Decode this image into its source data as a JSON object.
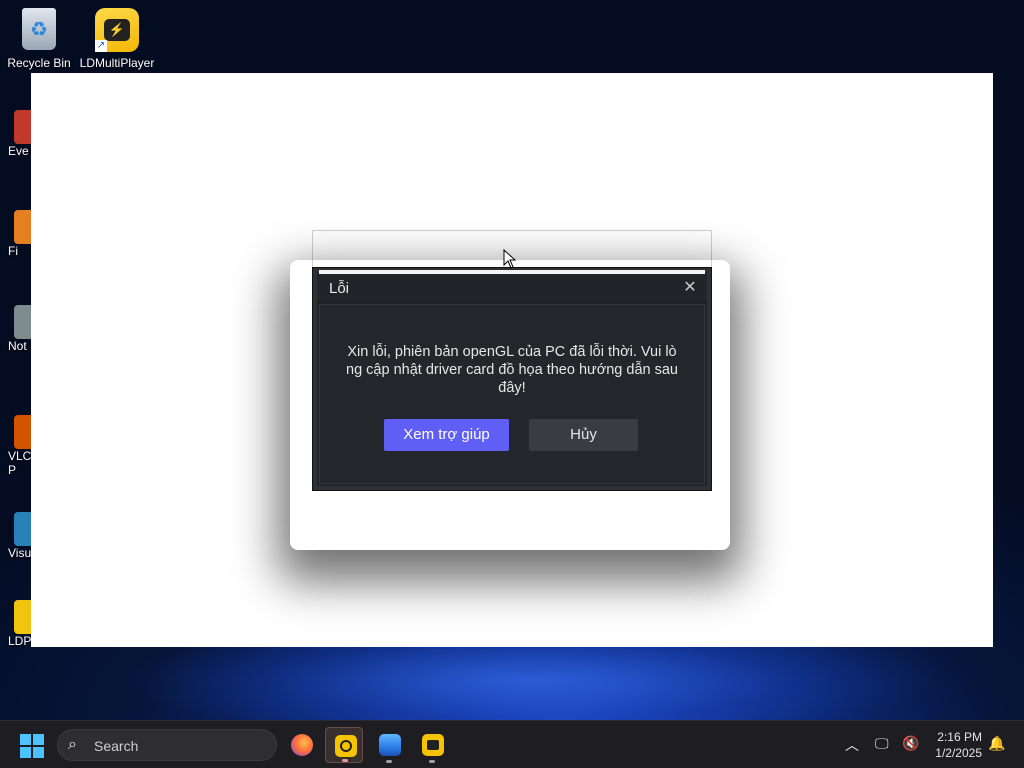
{
  "desktop": {
    "icons": [
      {
        "label": "Recycle Bin"
      },
      {
        "label": "LDMultiPlayer"
      }
    ],
    "side_labels": [
      "Eve",
      "Fi",
      "Not",
      "VLC",
      "P",
      "Visu",
      "LDP"
    ]
  },
  "dialog": {
    "title": "Lỗi",
    "close_glyph": "✕",
    "message": "Xin lỗi, phiên bản openGL của PC đã lỗi thời. Vui lò ng cập nhật driver card đồ họa theo hướng dẫn sau đây!",
    "primary_label": "Xem trợ giúp",
    "secondary_label": "Hủy"
  },
  "taskbar": {
    "search_placeholder": "Search",
    "clock_time": "2:16 PM",
    "clock_date": "1/2/2025",
    "apps": [
      "firefox-icon",
      "ldplayer-icon",
      "photos-icon",
      "ldmultiplayer-icon"
    ]
  },
  "colors": {
    "dialog_bg": "#222429",
    "primary_button": "#5f5ff6",
    "secondary_button": "#3b3c43",
    "taskbar": "#1e1e22"
  }
}
